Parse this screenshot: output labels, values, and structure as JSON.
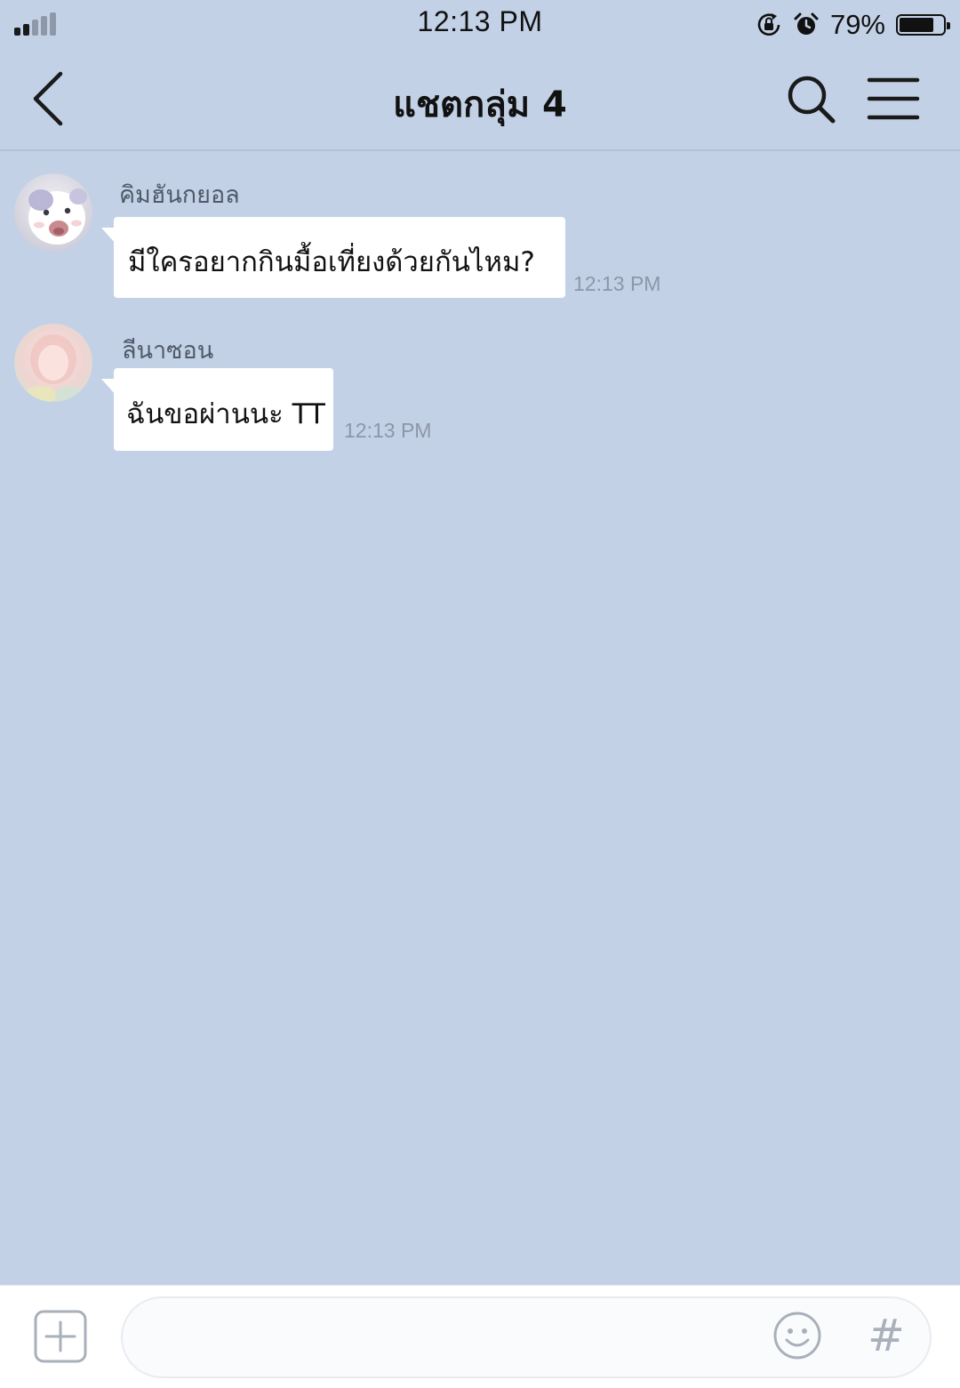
{
  "status_bar": {
    "time": "12:13 PM",
    "battery_percent": "79%",
    "battery_level": 0.79,
    "signal_bars": 2,
    "icons": [
      "signal-icon",
      "orientation-lock-icon",
      "alarm-icon",
      "battery-icon"
    ]
  },
  "nav": {
    "title": "แชตกลุ่ม 4",
    "icons": [
      "back-chevron-icon",
      "search-icon",
      "menu-icon"
    ]
  },
  "messages": [
    {
      "sender": "คิมฮันกยอล",
      "text": "มีใครอยากกินมื้อเที่ยงด้วยกันไหม?",
      "time": "12:13 PM",
      "avatar": "cartoon-avatar"
    },
    {
      "sender": "ลีนาซอน",
      "text": "ฉันขอผ่านนะ TT",
      "time": "12:13 PM",
      "avatar": "illustrated-avatar"
    }
  ],
  "input_bar": {
    "value": "",
    "placeholder": "",
    "icons": [
      "add-icon",
      "emoji-icon",
      "hashtag-icon"
    ],
    "hashtag_glyph": "#"
  },
  "colors": {
    "background": "#c3d1e7",
    "bubble": "#ffffff",
    "timestamp": "#8c97a7"
  }
}
